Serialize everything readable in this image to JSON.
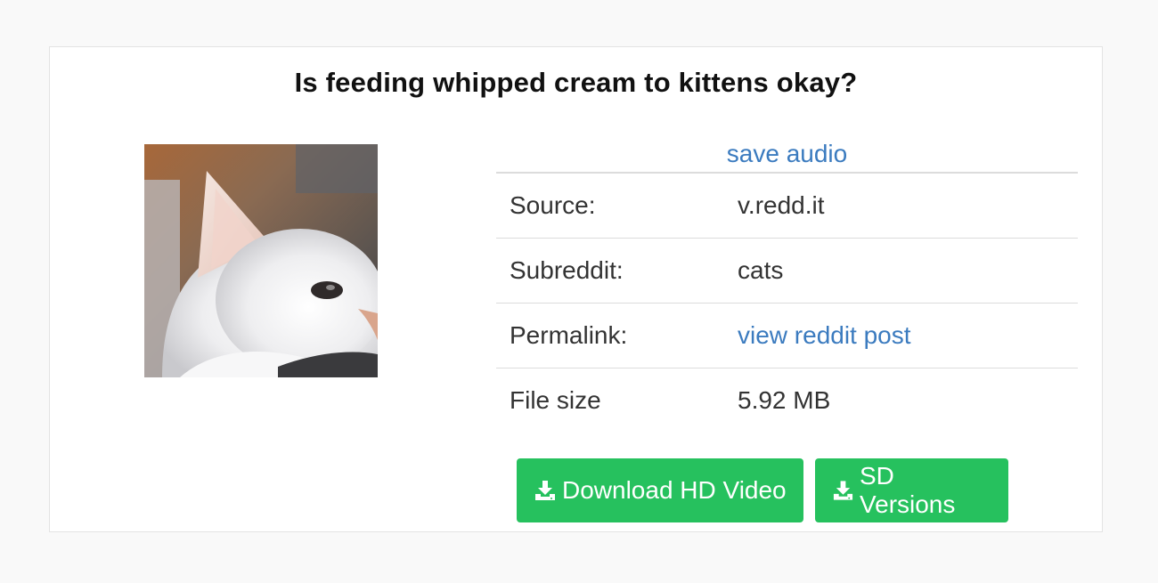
{
  "post": {
    "title": "Is feeding whipped cream to kittens okay?"
  },
  "thumbnail": {
    "alt": "kitten"
  },
  "info": {
    "save_audio_label": "save audio",
    "rows": [
      {
        "label": "Source:",
        "value": "v.redd.it"
      },
      {
        "label": "Subreddit:",
        "value": "cats"
      },
      {
        "label": "Permalink:",
        "value": "view reddit post"
      },
      {
        "label": "File size",
        "value": "5.92 MB"
      }
    ]
  },
  "actions": {
    "download_hd_label": "Download HD Video",
    "sd_versions_label": "SD Versions"
  },
  "colors": {
    "link": "#3b7bbf",
    "button_bg": "#26c15e",
    "button_text": "#ffffff"
  },
  "icons": {
    "download": "download-icon"
  }
}
